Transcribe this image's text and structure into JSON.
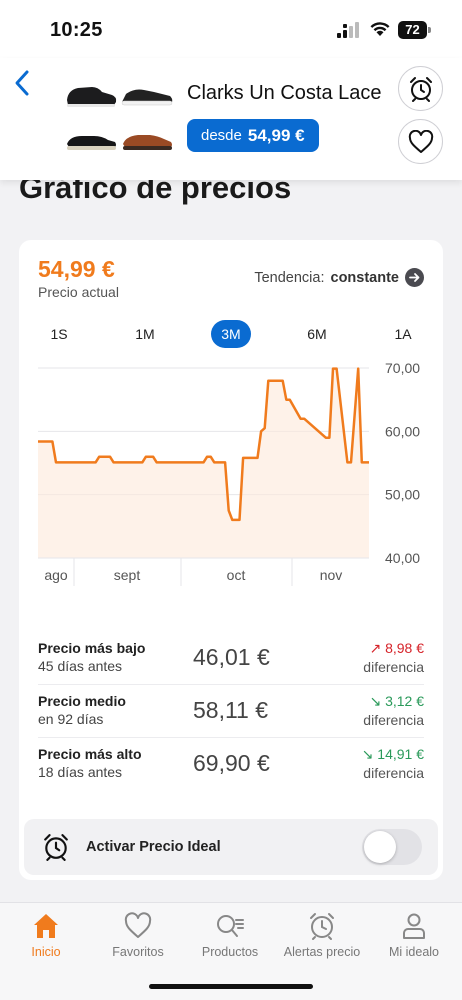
{
  "status": {
    "time": "10:25",
    "battery": "72"
  },
  "header": {
    "product_name": "Clarks Un Costa Lace",
    "price_from_label": "desde",
    "price_from_value": "54,99 €"
  },
  "page_title": "Gráfico de precios",
  "card": {
    "current_price": "54,99 €",
    "current_price_label": "Precio actual",
    "trend_label": "Tendencia:",
    "trend_value": "constante",
    "ranges": [
      "1S",
      "1M",
      "3M",
      "6M",
      "1A"
    ],
    "active_range": "3M"
  },
  "chart_data": {
    "type": "line",
    "title": "",
    "xlabel": "",
    "ylabel": "",
    "ylim": [
      40,
      70
    ],
    "y_ticks": [
      "70,00",
      "60,00",
      "50,00",
      "40,00"
    ],
    "x_ticks": [
      "ago",
      "sept",
      "oct",
      "nov"
    ],
    "x_range_days": [
      0,
      92
    ],
    "grid": true,
    "series": [
      {
        "color": "#f07b1d",
        "x": [
          0,
          4,
          5,
          16,
          17,
          20,
          21,
          29,
          30,
          32,
          33,
          46,
          47,
          48,
          49,
          52,
          53,
          54,
          56,
          57,
          61,
          62,
          63,
          64,
          68,
          69,
          70,
          73,
          74,
          80,
          81,
          82,
          83,
          86,
          87,
          89,
          90,
          92
        ],
        "values": [
          58.4,
          58.4,
          55.1,
          55.1,
          56,
          56,
          55.1,
          55.1,
          56,
          56,
          55.1,
          55.1,
          56,
          56,
          55.1,
          55.1,
          47.5,
          46.01,
          46.01,
          55.8,
          55.8,
          60,
          60.5,
          68,
          68,
          65,
          65,
          62,
          62,
          59,
          59,
          69.9,
          69.9,
          55.1,
          55.1,
          69.9,
          55.1,
          55.1
        ]
      }
    ]
  },
  "stats": [
    {
      "label": "Precio más bajo",
      "sub": "45 días antes",
      "value": "46,01 €",
      "diff": "↗ 8,98 €",
      "diff_label": "diferencia",
      "dir": "up"
    },
    {
      "label": "Precio medio",
      "sub": "en 92 días",
      "value": "58,11 €",
      "diff": "↘ 3,12 €",
      "diff_label": "diferencia",
      "dir": "down"
    },
    {
      "label": "Precio más alto",
      "sub": "18 días antes",
      "value": "69,90 €",
      "diff": "↘ 14,91 €",
      "diff_label": "diferencia",
      "dir": "down"
    }
  ],
  "ideal_price_label": "Activar Precio Ideal",
  "ideal_price_enabled": false,
  "tabs": [
    {
      "label": "Inicio",
      "icon": "home-icon",
      "active": true
    },
    {
      "label": "Favoritos",
      "icon": "heart-icon",
      "active": false
    },
    {
      "label": "Productos",
      "icon": "search-list-icon",
      "active": false
    },
    {
      "label": "Alertas precio",
      "icon": "alarm-clock-icon",
      "active": false
    },
    {
      "label": "Mi idealo",
      "icon": "user-icon",
      "active": false
    }
  ],
  "colors": {
    "accent": "#0a6bd1",
    "price": "#f07b1d",
    "up": "#d6232a",
    "down": "#2a9a5a"
  }
}
